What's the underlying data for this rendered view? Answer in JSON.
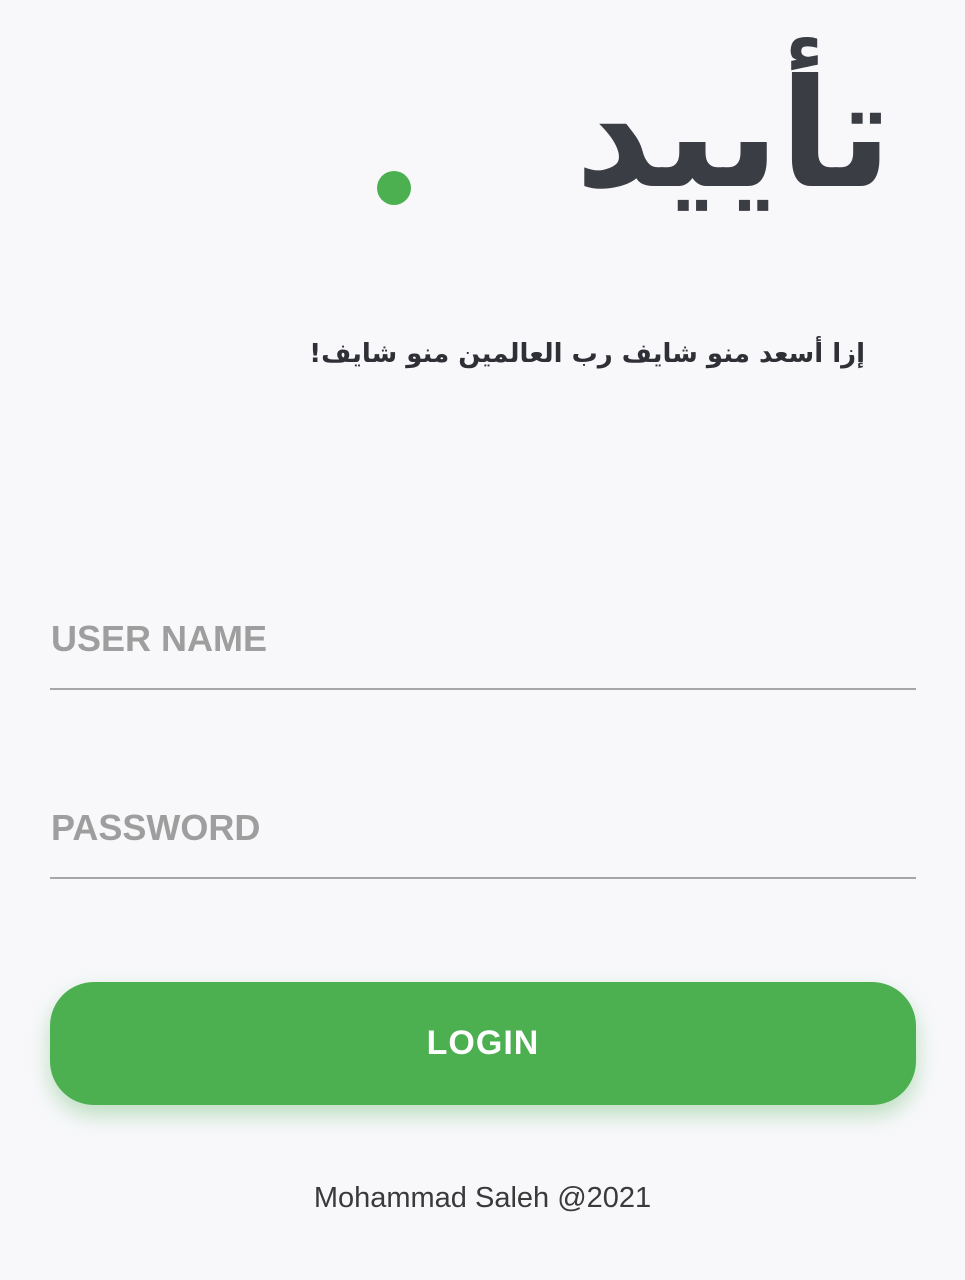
{
  "logo": {
    "text": "تأييد",
    "dot_color": "#4caf50",
    "text_color": "#3a3d44"
  },
  "tagline": "إزا أسعد منو شايف رب العالمين منو شايف!",
  "form": {
    "username_placeholder": "USER NAME",
    "username_value": "",
    "password_placeholder": "PASSWORD",
    "password_value": "",
    "login_label": "LOGIN"
  },
  "footer": {
    "credit": "Mohammad Saleh @2021"
  },
  "colors": {
    "accent": "#4caf50",
    "background": "#f8f8fb",
    "placeholder": "#9e9e9e",
    "underline": "#a6a6a6"
  }
}
